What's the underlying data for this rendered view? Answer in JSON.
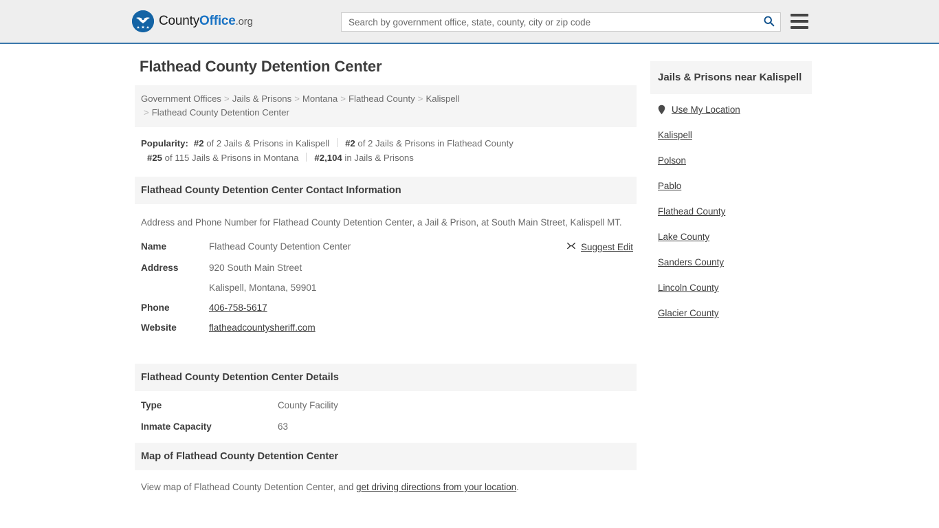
{
  "header": {
    "brand": {
      "part1": "County",
      "part2": "Office",
      "part3": ".org",
      "icon": "eagle-seal-icon"
    },
    "search": {
      "placeholder": "Search by government office, state, county, city or zip code",
      "value": "",
      "icon": "search-icon"
    },
    "menu": {
      "icon": "hamburger-menu-icon",
      "label": "Menu"
    },
    "accent_color": "#3a78ab"
  },
  "page_title": "Flathead County Detention Center",
  "breadcrumb": {
    "separator": ">",
    "items": [
      {
        "label": "Government Offices",
        "link": true
      },
      {
        "label": "Jails & Prisons",
        "link": true
      },
      {
        "label": "Montana",
        "link": true
      },
      {
        "label": "Flathead County",
        "link": true
      },
      {
        "label": "Kalispell",
        "link": true
      },
      {
        "label": "Flathead County Detention Center",
        "link": false
      }
    ]
  },
  "popularity": {
    "label": "Popularity:",
    "entries": [
      {
        "rank": "#2",
        "rest": " of 2 Jails & Prisons in Kalispell"
      },
      {
        "rank": "#2",
        "rest": " of 2 Jails & Prisons in Flathead County"
      },
      {
        "rank": "#25",
        "rest": " of 115 Jails & Prisons in Montana"
      },
      {
        "rank": "#2,104",
        "rest": " in Jails & Prisons"
      }
    ]
  },
  "contact": {
    "heading": "Flathead County Detention Center Contact Information",
    "description": "Address and Phone Number for Flathead County Detention Center, a Jail & Prison, at South Main Street, Kalispell MT.",
    "suggest_edit": {
      "label": "Suggest Edit",
      "icon": "edit-pencil-icon"
    },
    "rows": [
      {
        "key": "Name",
        "value": "Flathead County Detention Center",
        "link": false
      },
      {
        "key": "Address",
        "value": "920 South Main Street",
        "value2": "Kalispell, Montana, 59901",
        "link": false
      },
      {
        "key": "Phone",
        "value": "406-758-5617",
        "link": true
      },
      {
        "key": "Website",
        "value": "flatheadcountysheriff.com",
        "link": true
      }
    ]
  },
  "details": {
    "heading": "Flathead County Detention Center Details",
    "rows": [
      {
        "key": "Type",
        "value": "County Facility"
      },
      {
        "key": "Inmate Capacity",
        "value": "63"
      }
    ]
  },
  "map": {
    "heading": "Map of Flathead County Detention Center",
    "text_before": "View map of Flathead County Detention Center, and ",
    "link": "get driving directions from your location",
    "text_after": "."
  },
  "sidebar": {
    "heading": "Jails & Prisons near Kalispell",
    "use_my_location": {
      "label": "Use My Location",
      "icon": "map-pin-icon"
    },
    "links": [
      {
        "label": "Kalispell"
      },
      {
        "label": "Polson"
      },
      {
        "label": "Pablo"
      },
      {
        "label": "Flathead County"
      },
      {
        "label": "Lake County"
      },
      {
        "label": "Sanders County"
      },
      {
        "label": "Lincoln County"
      },
      {
        "label": "Glacier County"
      }
    ]
  }
}
